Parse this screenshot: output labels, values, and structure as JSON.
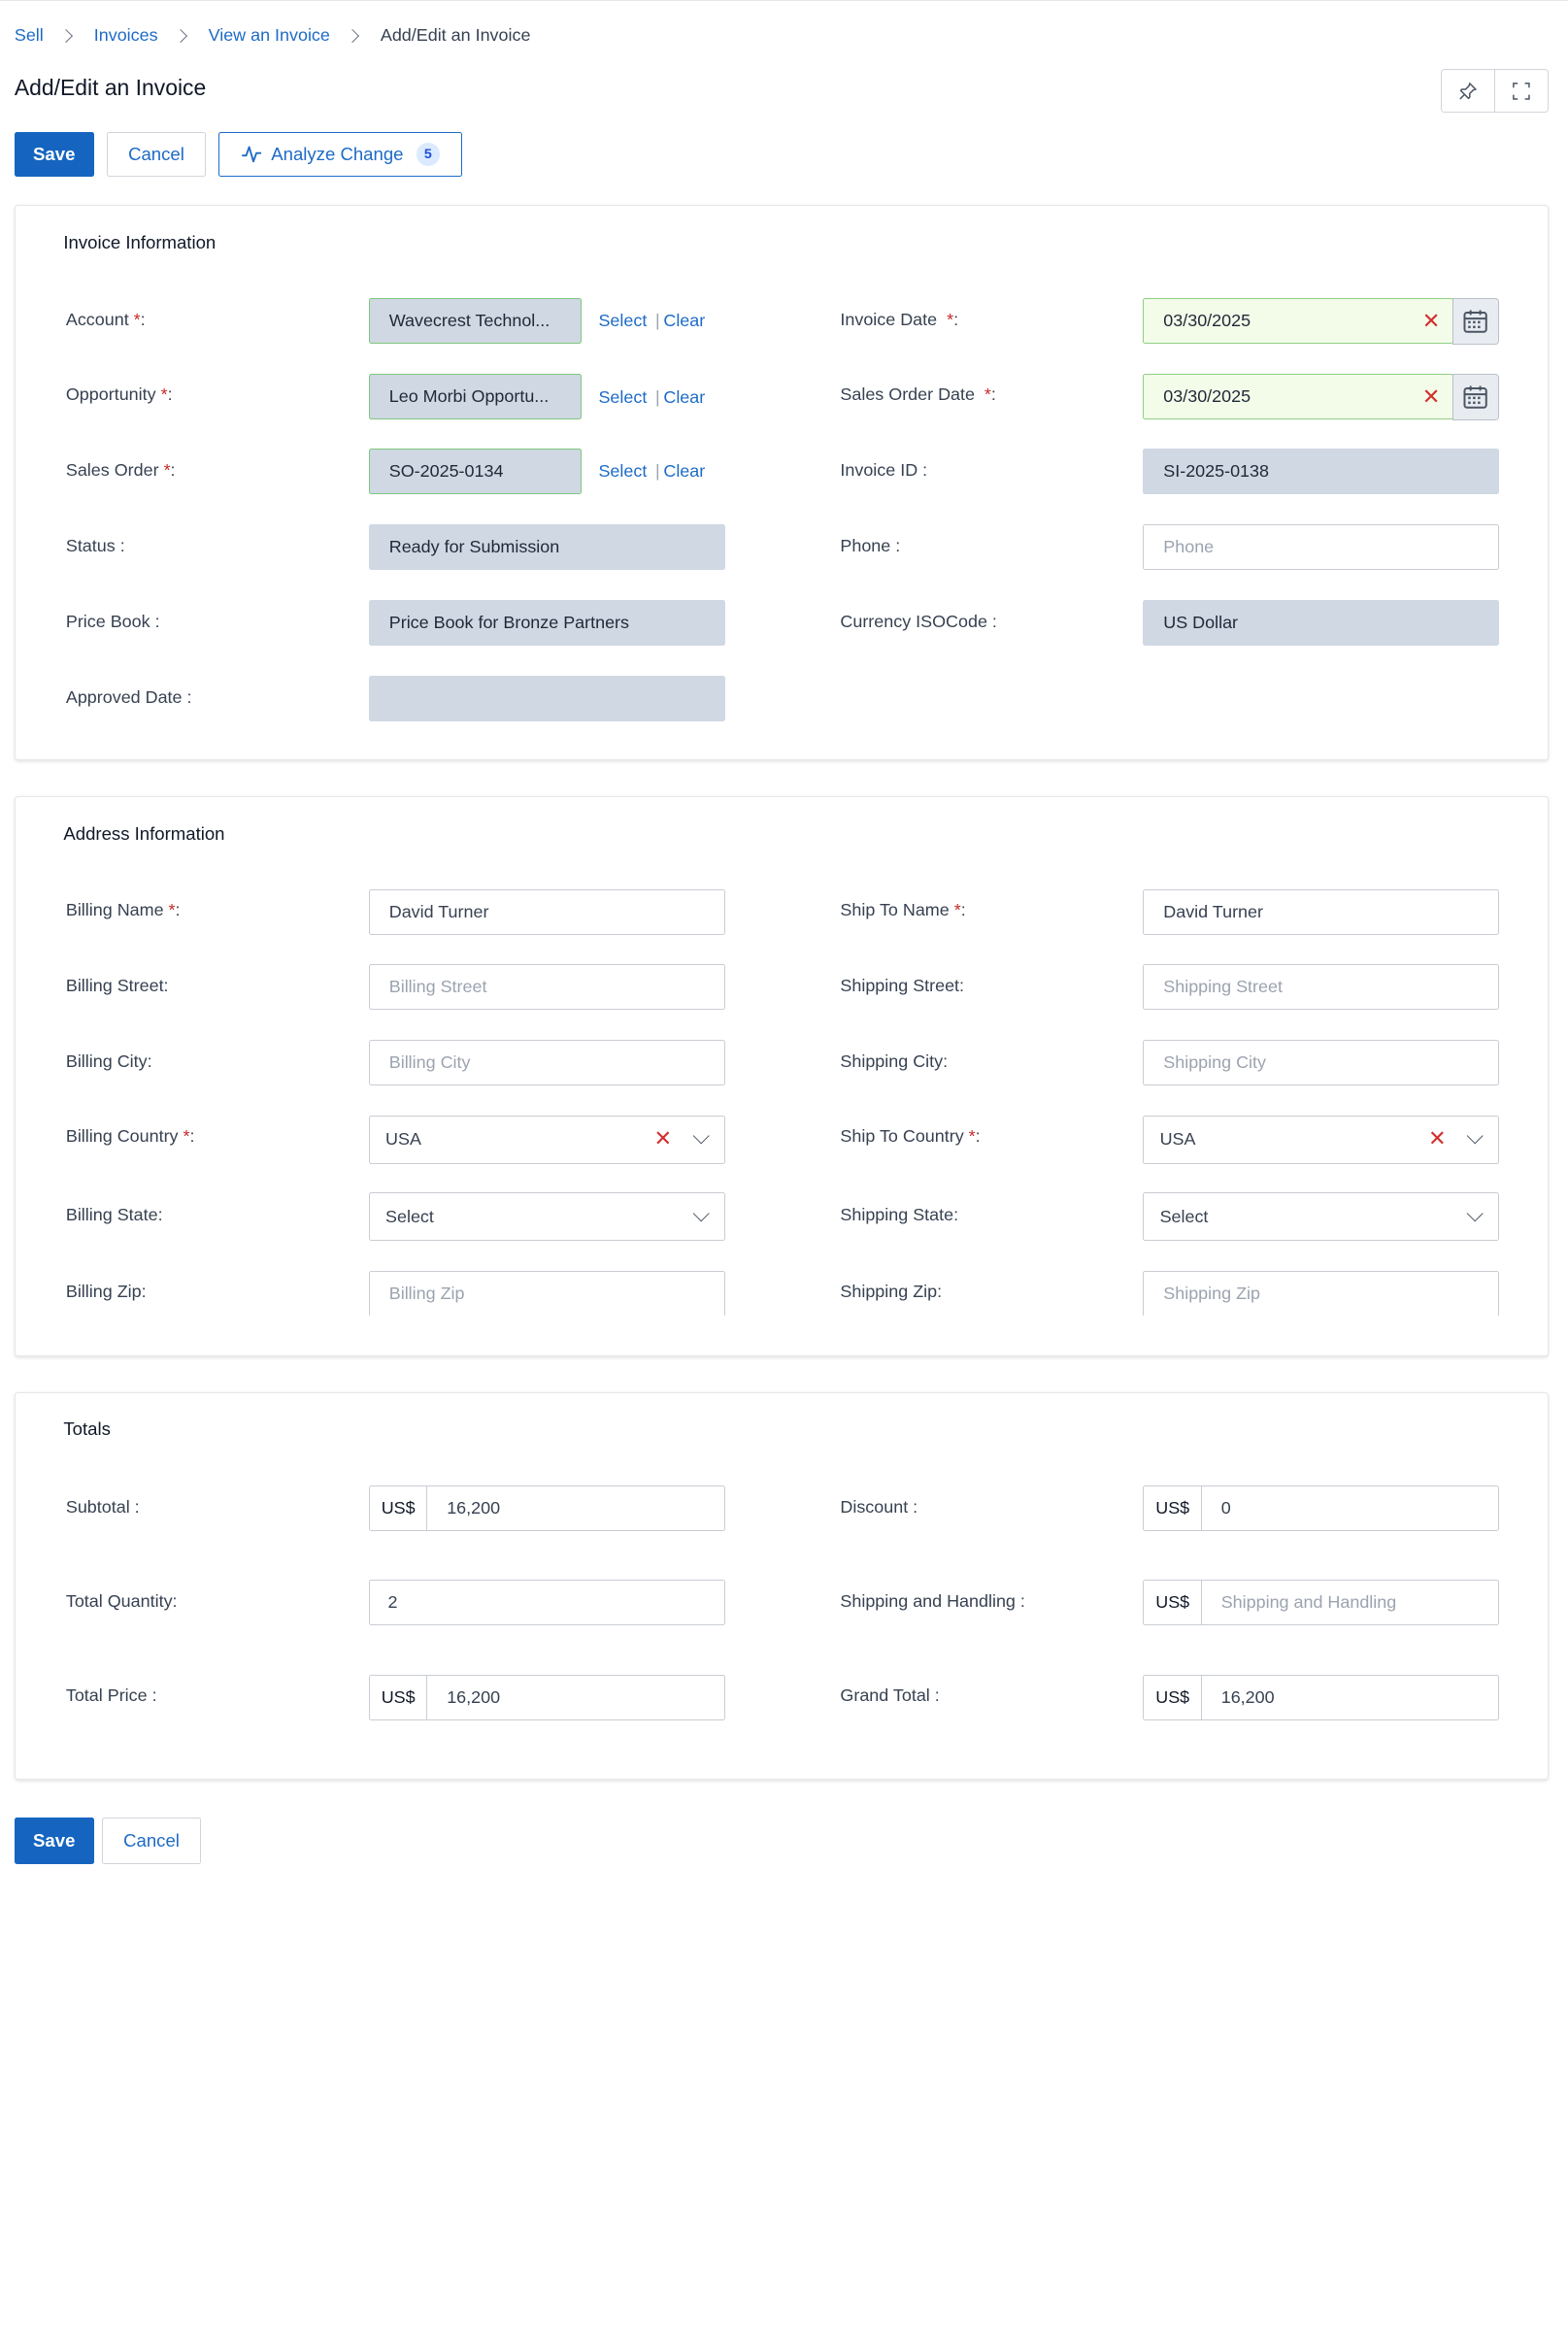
{
  "breadcrumb": [
    "Sell",
    "Invoices",
    "View an Invoice",
    "Add/Edit an Invoice"
  ],
  "page_title": "Add/Edit an Invoice",
  "toolbar": {
    "save": "Save",
    "cancel": "Cancel",
    "analyze": "Analyze Change",
    "analyze_count": "5"
  },
  "invoice_info": {
    "title": "Invoice Information",
    "account": {
      "label": "Account",
      "value": "Wavecrest Technol..."
    },
    "opportunity": {
      "label": "Opportunity",
      "value": "Leo Morbi Opportu..."
    },
    "sales_order": {
      "label": "Sales Order",
      "value": "SO-2025-0134"
    },
    "select_label": "Select",
    "clear_label": "Clear",
    "status": {
      "label": "Status :",
      "value": "Ready for Submission"
    },
    "price_book": {
      "label": "Price Book :",
      "value": "Price Book for Bronze Partners"
    },
    "approved_date": {
      "label": "Approved Date :",
      "value": ""
    },
    "invoice_date": {
      "label": "Invoice Date",
      "value": "03/30/2025"
    },
    "sales_order_date": {
      "label": "Sales Order Date",
      "value": "03/30/2025"
    },
    "invoice_id": {
      "label": "Invoice ID :",
      "value": "SI-2025-0138"
    },
    "phone": {
      "label": "Phone :",
      "placeholder": "Phone"
    },
    "currency": {
      "label": "Currency ISOCode :",
      "value": "US Dollar"
    }
  },
  "address_info": {
    "title": "Address Information",
    "billing_name": {
      "label": "Billing Name",
      "value": "David Turner"
    },
    "billing_street": {
      "label": "Billing Street:",
      "placeholder": "Billing Street"
    },
    "billing_city": {
      "label": "Billing City:",
      "placeholder": "Billing City"
    },
    "billing_country": {
      "label": "Billing Country",
      "value": "USA"
    },
    "billing_state": {
      "label": "Billing State:",
      "value": "Select"
    },
    "billing_zip": {
      "label": "Billing Zip:",
      "placeholder": "Billing Zip"
    },
    "ship_name": {
      "label": "Ship To Name",
      "value": "David Turner"
    },
    "shipping_street": {
      "label": "Shipping Street:",
      "placeholder": "Shipping Street"
    },
    "shipping_city": {
      "label": "Shipping City:",
      "placeholder": "Shipping City"
    },
    "ship_country": {
      "label": "Ship To Country",
      "value": "USA"
    },
    "shipping_state": {
      "label": "Shipping State:",
      "value": "Select"
    },
    "shipping_zip": {
      "label": "Shipping Zip:",
      "placeholder": "Shipping Zip"
    }
  },
  "totals": {
    "title": "Totals",
    "currency_prefix": "US$",
    "subtotal": {
      "label": "Subtotal :",
      "value": "16,200"
    },
    "total_quantity": {
      "label": "Total Quantity:",
      "value": "2"
    },
    "total_price": {
      "label": "Total Price :",
      "value": "16,200"
    },
    "discount": {
      "label": "Discount :",
      "value": "0"
    },
    "shipping_handling": {
      "label": "Shipping and Handling :",
      "placeholder": "Shipping and Handling"
    },
    "grand_total": {
      "label": "Grand Total :",
      "value": "16,200"
    }
  },
  "footer": {
    "save": "Save",
    "cancel": "Cancel"
  },
  "colors": {
    "primary": "#1565c0",
    "link": "#1d6bc6",
    "required": "#c62828",
    "readonly_bg": "#cfd8e3",
    "date_bg": "#f3fce9"
  },
  "icons": [
    "chevron-right-icon",
    "pin-icon",
    "fullscreen-icon",
    "activity-icon",
    "clear-x-icon",
    "calendar-icon",
    "chevron-down-icon"
  ]
}
